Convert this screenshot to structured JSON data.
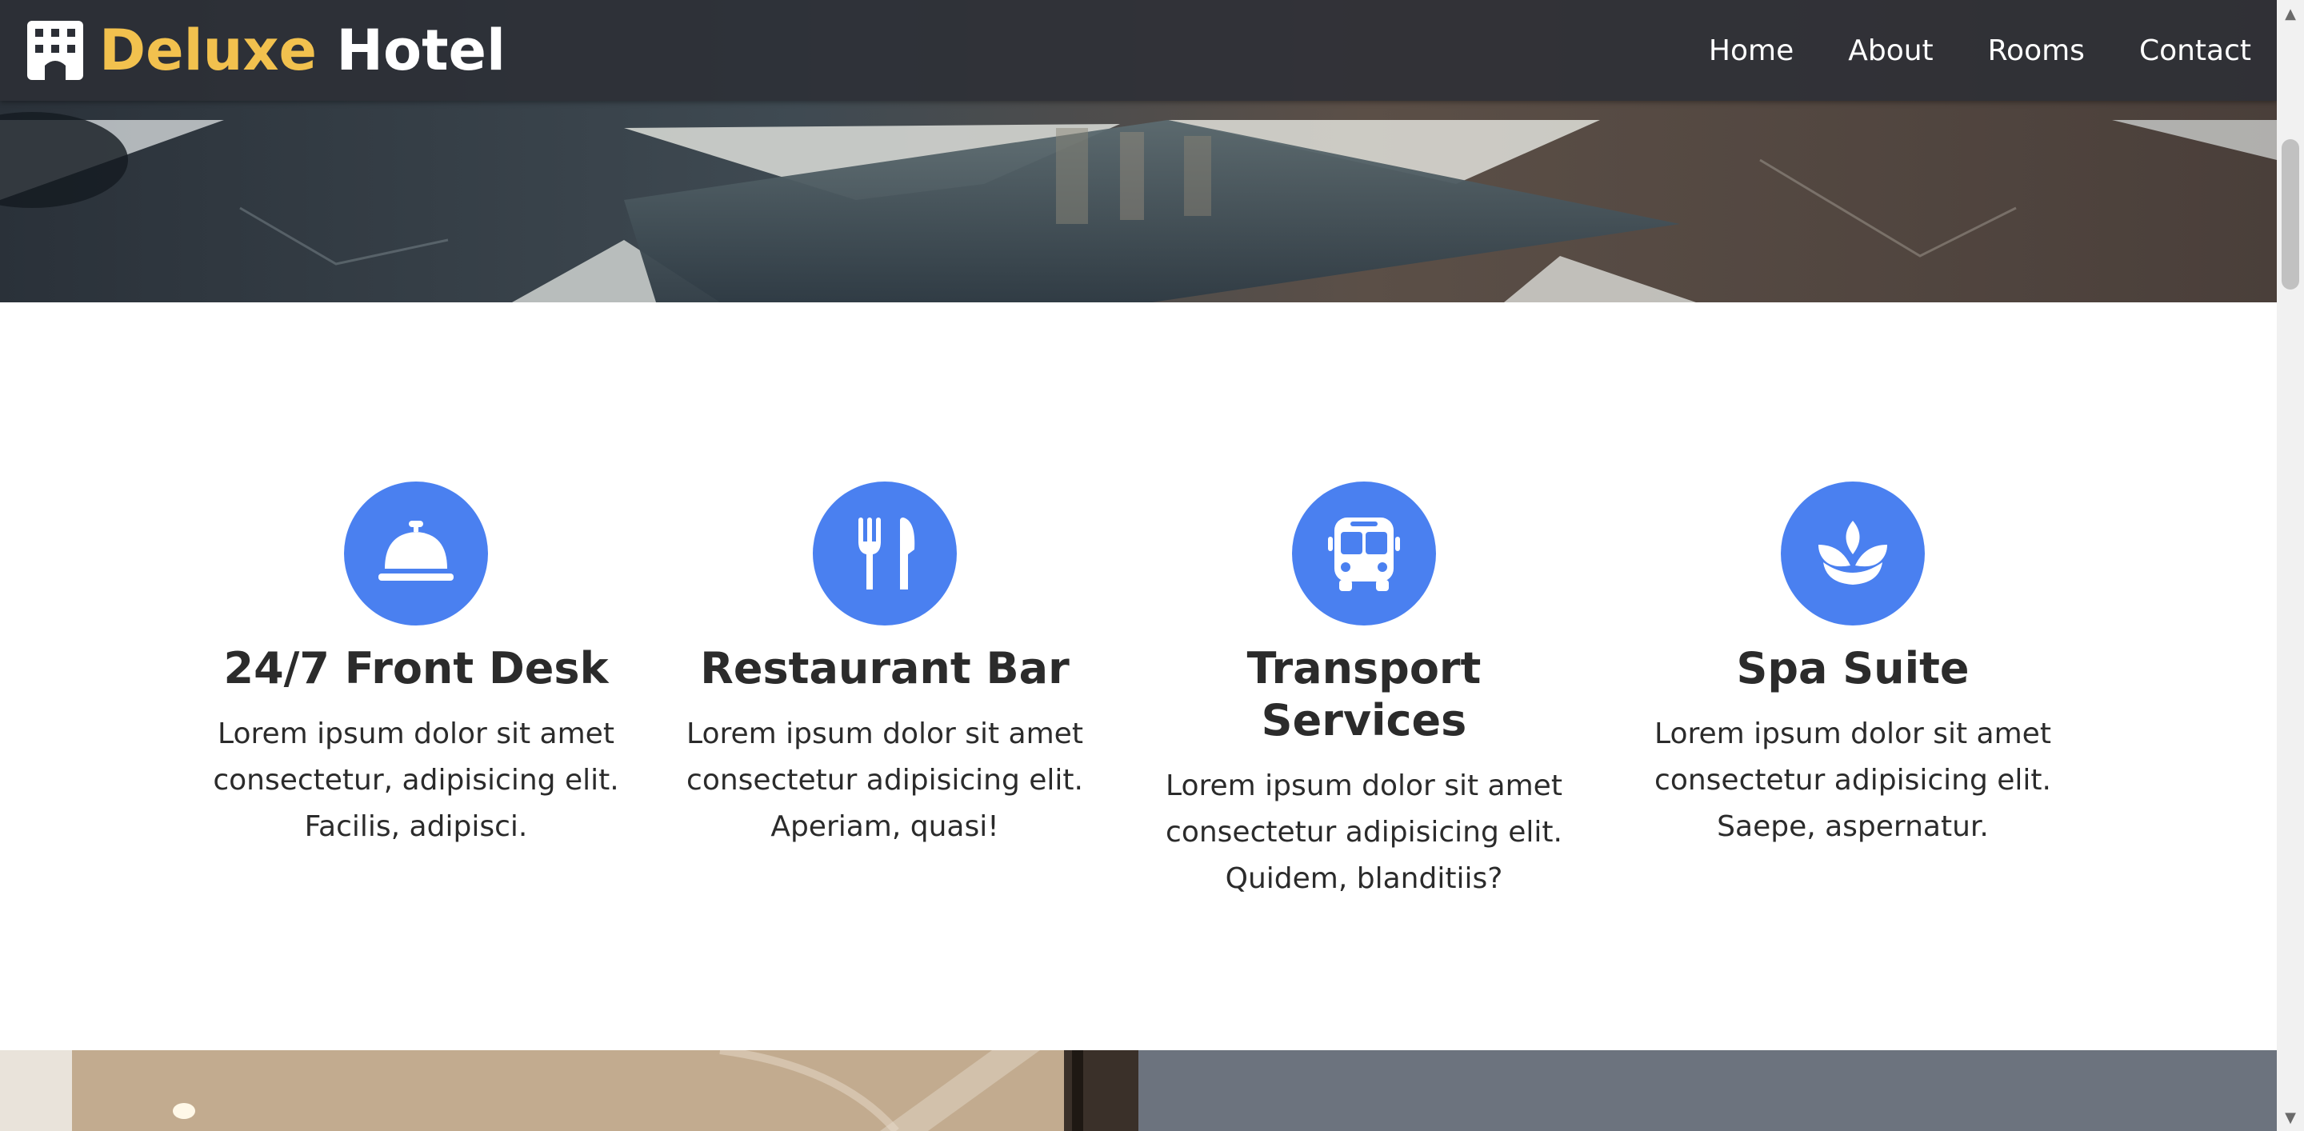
{
  "brand": {
    "word1": "Deluxe",
    "word2": "Hotel",
    "icon": "hotel-building-icon"
  },
  "nav": [
    {
      "label": "Home"
    },
    {
      "label": "About"
    },
    {
      "label": "Rooms"
    },
    {
      "label": "Contact"
    }
  ],
  "services": [
    {
      "icon": "concierge-bell-icon",
      "title": "24/7 Front Desk",
      "text": "Lorem ipsum dolor sit amet consectetur, adipisicing elit. Facilis, adipisci."
    },
    {
      "icon": "utensils-icon",
      "title": "Restaurant Bar",
      "text": "Lorem ipsum dolor sit amet consectetur adipisicing elit. Aperiam, quasi!"
    },
    {
      "icon": "bus-icon",
      "title": "Transport Services",
      "text": "Lorem ipsum dolor sit amet consectetur adipisicing elit. Quidem, blanditiis?"
    },
    {
      "icon": "spa-icon",
      "title": "Spa Suite",
      "text": "Lorem ipsum dolor sit amet consectetur adipisicing elit. Saepe, aspernatur."
    }
  ],
  "colors": {
    "accent": "#4a80f0",
    "brand_gold": "#f2c14e",
    "navbar": "#2c2f36",
    "bottom_panel": "#6c737e"
  }
}
